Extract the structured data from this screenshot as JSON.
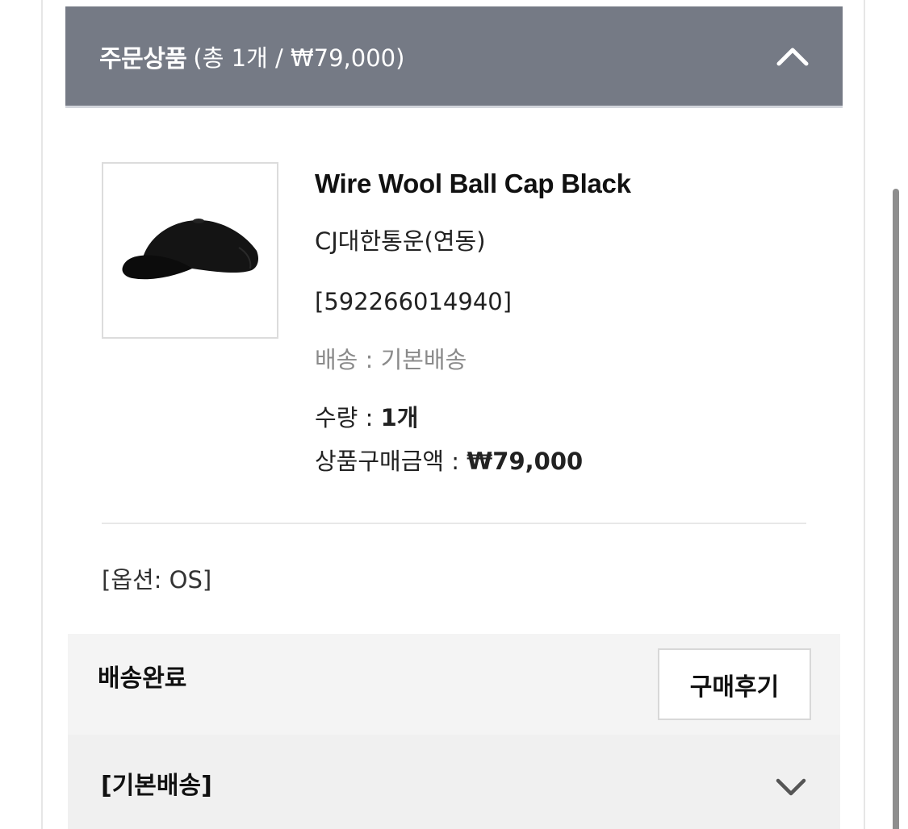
{
  "order_section": {
    "title": "주문상품",
    "summary": "(총 1개 / ₩79,000)",
    "collapse_icon": "chevron-up-icon"
  },
  "product": {
    "name": "Wire Wool Ball Cap Black",
    "carrier": "CJ대한통운(연동)",
    "tracking": "[592266014940]",
    "shipping_type": "배송 : 기본배송",
    "quantity_label": "수량 : ",
    "quantity_value": "1개",
    "price_label": "상품구매금액 : ",
    "price_value": "₩79,000",
    "image_icon": "black-cap-image"
  },
  "option": "[옵션: OS]",
  "status": {
    "label": "배송완료",
    "review_button": "구매후기"
  },
  "shipping_group": {
    "label": "[기본배송]",
    "expand_icon": "chevron-down-icon"
  },
  "colors": {
    "header_bg": "#757a85",
    "status_bg": "#f4f4f4",
    "muted_text": "#8a8a8a"
  }
}
